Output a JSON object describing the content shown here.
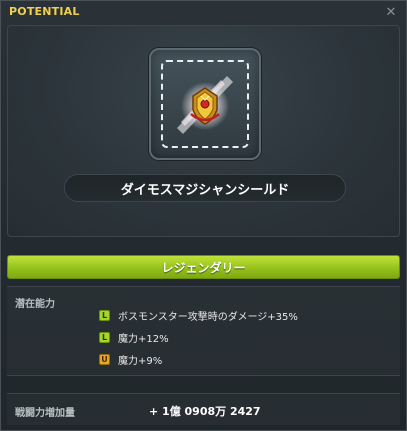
{
  "window": {
    "title": "POTENTIAL",
    "close_icon": "close-icon"
  },
  "item": {
    "name": "ダイモスマジシャンシールド",
    "icon": "golden-shield-icon"
  },
  "grade": {
    "label": "レジェンダリー",
    "color": "#a6d626"
  },
  "potential": {
    "section_label": "潜在能力",
    "lines": [
      {
        "badge": "L",
        "text": "ボスモンスター攻撃時のダメージ+35%"
      },
      {
        "badge": "L",
        "text": "魔力+12%"
      },
      {
        "badge": "U",
        "text": "魔力+9%"
      }
    ]
  },
  "combat_power": {
    "label": "戦闘力増加量",
    "value": "+ 1億 0908万 2427"
  },
  "colors": {
    "title": "#f0d050",
    "legendary": "#a6d626",
    "unique": "#e8a820"
  }
}
